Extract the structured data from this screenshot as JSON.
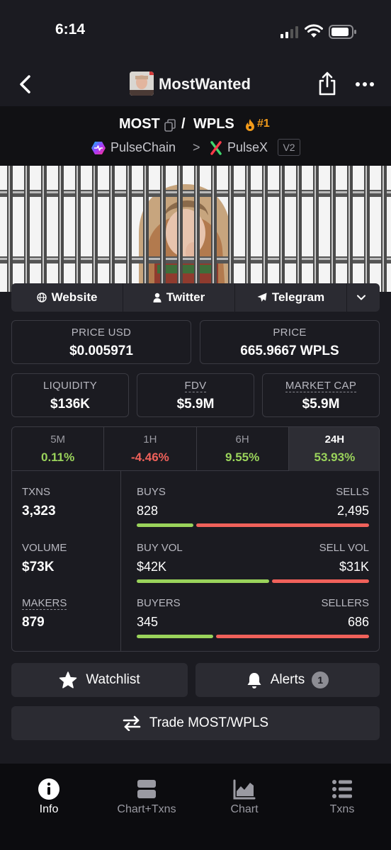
{
  "status_bar": {
    "time": "6:14"
  },
  "header": {
    "title": "MostWanted",
    "avatar": "profile-avatar"
  },
  "pair": {
    "base": "MOST",
    "slash": "/",
    "quote": "WPLS",
    "rank": "#1",
    "chain": "PulseChain",
    "separator": ">",
    "dex": "PulseX",
    "version": "V2"
  },
  "links": {
    "website": "Website",
    "twitter": "Twitter",
    "telegram": "Telegram"
  },
  "stats": {
    "price_usd_label": "PRICE USD",
    "price_usd": "$0.005971",
    "price_label": "PRICE",
    "price": "665.9667 WPLS",
    "liquidity_label": "LIQUIDITY",
    "liquidity": "$136K",
    "fdv_label": "FDV",
    "fdv": "$5.9M",
    "mcap_label": "MARKET CAP",
    "mcap": "$5.9M"
  },
  "timeframes": [
    {
      "label": "5M",
      "value": "0.11%",
      "direction": "up"
    },
    {
      "label": "1H",
      "value": "-4.46%",
      "direction": "down"
    },
    {
      "label": "6H",
      "value": "9.55%",
      "direction": "up"
    },
    {
      "label": "24H",
      "value": "53.93%",
      "direction": "up",
      "active": true
    }
  ],
  "metrics": {
    "txns_label": "TXNS",
    "txns": "3,323",
    "volume_label": "VOLUME",
    "volume": "$73K",
    "makers_label": "MAKERS",
    "makers": "879"
  },
  "ratios": {
    "buys_label": "BUYS",
    "buys": "828",
    "sells_label": "SELLS",
    "sells": "2,495",
    "buy_vol_label": "BUY VOL",
    "buy_vol": "$42K",
    "sell_vol_label": "SELL VOL",
    "sell_vol": "$31K",
    "buyers_label": "BUYERS",
    "buyers": "345",
    "sellers_label": "SELLERS",
    "sellers": "686",
    "buys_fraction": 0.25,
    "buy_vol_fraction": 0.575,
    "buyers_fraction": 0.335
  },
  "actions": {
    "watchlist": "Watchlist",
    "alerts": "Alerts",
    "alerts_count": "1",
    "trade": "Trade MOST/WPLS"
  },
  "tabs": [
    {
      "label": "Info",
      "icon": "info-icon",
      "active": true
    },
    {
      "label": "Chart+Txns",
      "icon": "chart-txns-icon"
    },
    {
      "label": "Chart",
      "icon": "chart-icon"
    },
    {
      "label": "Txns",
      "icon": "list-icon"
    }
  ],
  "colors": {
    "background": "#1b1b21",
    "positive": "#9ad35b",
    "negative": "#f0615a",
    "rank": "#f29b1b"
  }
}
